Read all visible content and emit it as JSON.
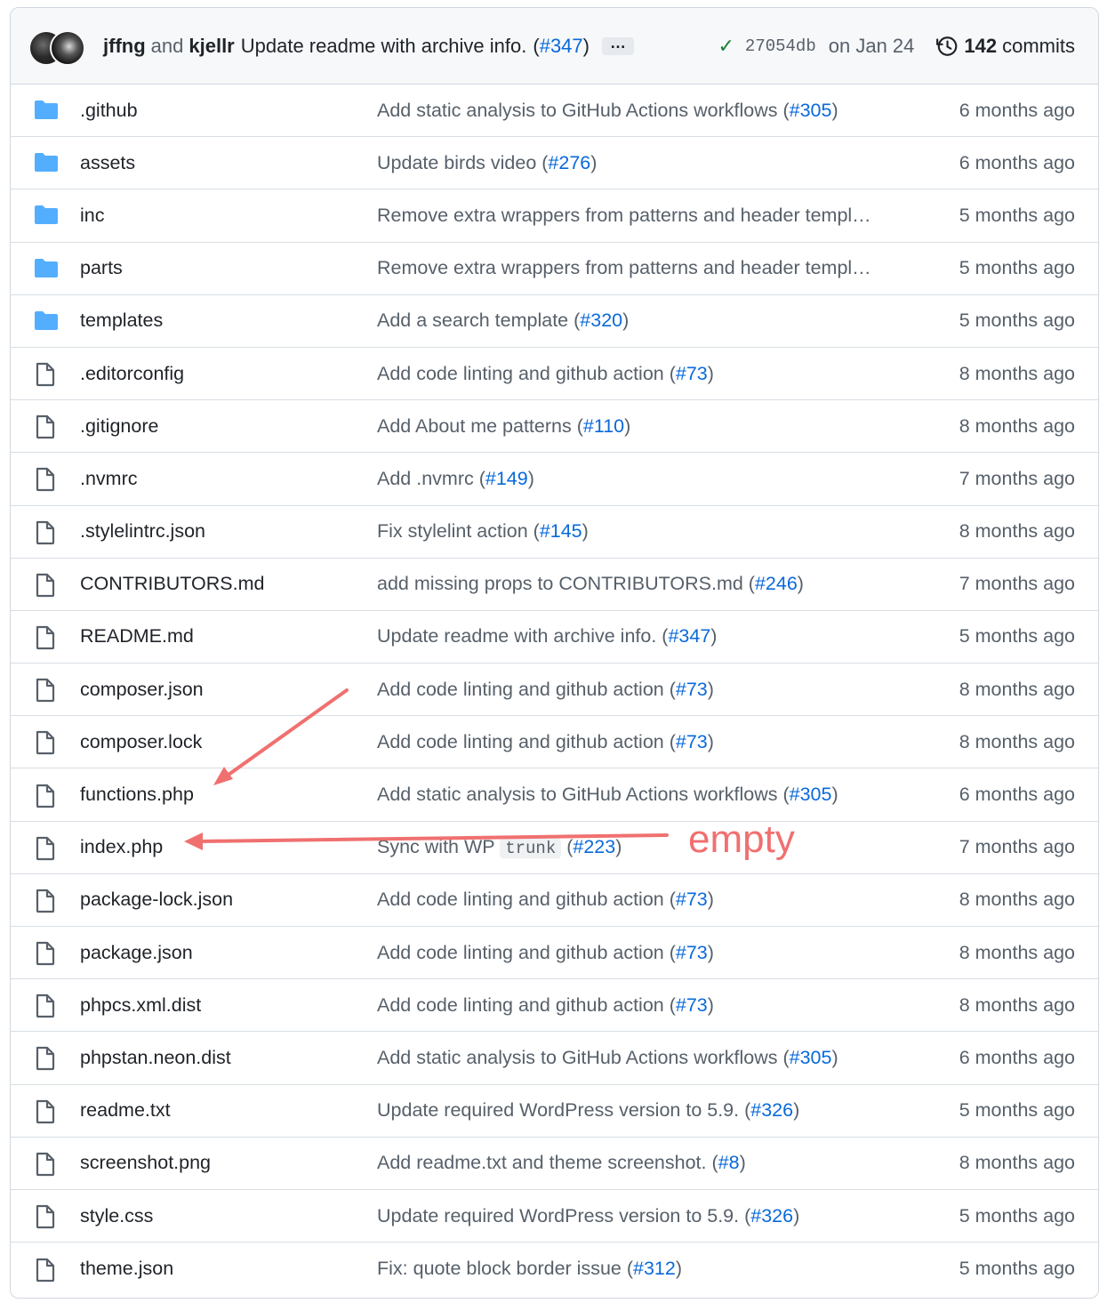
{
  "header": {
    "author1": "jffng",
    "and": "and",
    "author2": "kjellr",
    "message": "Update readme with archive info.",
    "pr_open": "(",
    "pr": "#347",
    "pr_close": ")",
    "ellipsis": "…",
    "sha": "27054db",
    "date": "on Jan 24",
    "commit_count": "142",
    "commits_label": "commits"
  },
  "files": [
    {
      "type": "folder",
      "name": ".github",
      "msg": "Add static analysis to GitHub Actions workflows",
      "pr": "#305",
      "age": "6 months ago"
    },
    {
      "type": "folder",
      "name": "assets",
      "msg": "Update birds video",
      "pr": "#276",
      "age": "6 months ago"
    },
    {
      "type": "folder",
      "name": "inc",
      "msg": "Remove extra wrappers from patterns and header templ…",
      "pr": "",
      "age": "5 months ago"
    },
    {
      "type": "folder",
      "name": "parts",
      "msg": "Remove extra wrappers from patterns and header templ…",
      "pr": "",
      "age": "5 months ago"
    },
    {
      "type": "folder",
      "name": "templates",
      "msg": "Add a search template",
      "pr": "#320",
      "age": "5 months ago"
    },
    {
      "type": "file",
      "name": ".editorconfig",
      "msg": "Add code linting and github action",
      "pr": "#73",
      "age": "8 months ago"
    },
    {
      "type": "file",
      "name": ".gitignore",
      "msg": "Add About me patterns",
      "pr": "#110",
      "age": "8 months ago"
    },
    {
      "type": "file",
      "name": ".nvmrc",
      "msg": "Add .nvmrc",
      "pr": "#149",
      "age": "7 months ago"
    },
    {
      "type": "file",
      "name": ".stylelintrc.json",
      "msg": "Fix stylelint action",
      "pr": "#145",
      "age": "8 months ago"
    },
    {
      "type": "file",
      "name": "CONTRIBUTORS.md",
      "msg": "add missing props to CONTRIBUTORS.md",
      "pr": "#246",
      "age": "7 months ago"
    },
    {
      "type": "file",
      "name": "README.md",
      "msg": "Update readme with archive info.",
      "pr": "#347",
      "age": "5 months ago"
    },
    {
      "type": "file",
      "name": "composer.json",
      "msg": "Add code linting and github action",
      "pr": "#73",
      "age": "8 months ago"
    },
    {
      "type": "file",
      "name": "composer.lock",
      "msg": "Add code linting and github action",
      "pr": "#73",
      "age": "8 months ago"
    },
    {
      "type": "file",
      "name": "functions.php",
      "msg": "Add static analysis to GitHub Actions workflows",
      "pr": "#305",
      "age": "6 months ago"
    },
    {
      "type": "file",
      "name": "index.php",
      "msg": "Sync with WP",
      "code": "trunk",
      "pr": "#223",
      "age": "7 months ago"
    },
    {
      "type": "file",
      "name": "package-lock.json",
      "msg": "Add code linting and github action",
      "pr": "#73",
      "age": "8 months ago"
    },
    {
      "type": "file",
      "name": "package.json",
      "msg": "Add code linting and github action",
      "pr": "#73",
      "age": "8 months ago"
    },
    {
      "type": "file",
      "name": "phpcs.xml.dist",
      "msg": "Add code linting and github action",
      "pr": "#73",
      "age": "8 months ago"
    },
    {
      "type": "file",
      "name": "phpstan.neon.dist",
      "msg": "Add static analysis to GitHub Actions workflows",
      "pr": "#305",
      "age": "6 months ago"
    },
    {
      "type": "file",
      "name": "readme.txt",
      "msg": "Update required WordPress version to 5.9.",
      "pr": "#326",
      "age": "5 months ago"
    },
    {
      "type": "file",
      "name": "screenshot.png",
      "msg": "Add readme.txt and theme screenshot.",
      "pr": "#8",
      "age": "8 months ago"
    },
    {
      "type": "file",
      "name": "style.css",
      "msg": "Update required WordPress version to 5.9.",
      "pr": "#326",
      "age": "5 months ago"
    },
    {
      "type": "file",
      "name": "theme.json",
      "msg": "Fix: quote block border issue",
      "pr": "#312",
      "age": "5 months ago"
    }
  ],
  "annotation": {
    "label": "empty",
    "color": "#f07070"
  },
  "colors": {
    "link": "#0969da",
    "folder": "#54aeff",
    "muted": "#57606a",
    "success": "#1a7f37"
  }
}
